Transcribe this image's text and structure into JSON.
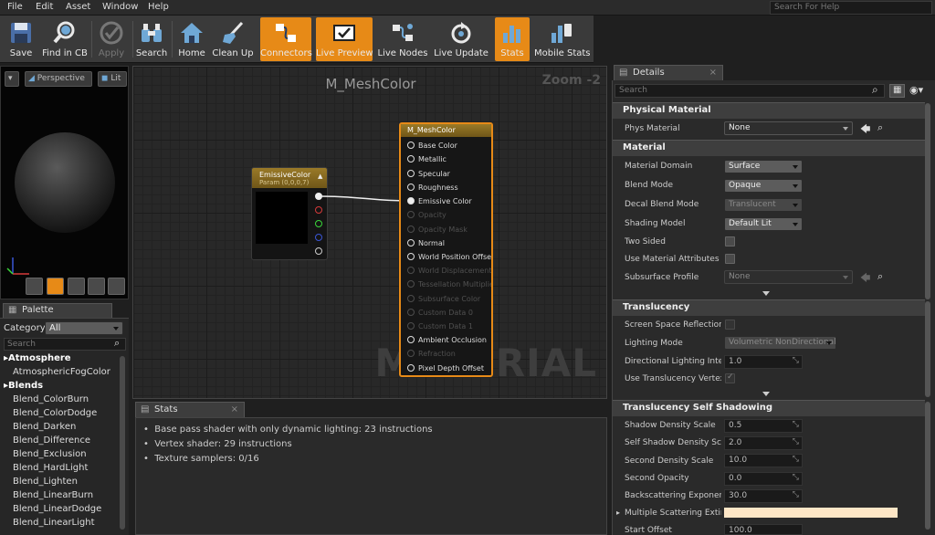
{
  "menu": [
    "File",
    "Edit",
    "Asset",
    "Window",
    "Help"
  ],
  "help_search_placeholder": "Search For Help",
  "toolbar": {
    "buttons": [
      {
        "label": "Save",
        "icon": "save-icon",
        "active": false,
        "enabled": true
      },
      {
        "label": "Find in CB",
        "icon": "find-in-content-browser-icon",
        "active": false,
        "enabled": true
      },
      {
        "label": "Apply",
        "icon": "apply-checkmark-icon",
        "active": false,
        "enabled": false
      },
      {
        "label": "Search",
        "icon": "binoculars-icon",
        "active": false,
        "enabled": true
      },
      {
        "label": "Home",
        "icon": "home-icon",
        "active": false,
        "enabled": true
      },
      {
        "label": "Clean Up",
        "icon": "broom-icon",
        "active": false,
        "enabled": true
      },
      {
        "label": "Connectors",
        "icon": "connectors-icon",
        "active": true,
        "enabled": true
      },
      {
        "label": "Live Preview",
        "icon": "live-preview-icon",
        "active": true,
        "enabled": true
      },
      {
        "label": "Live Nodes",
        "icon": "live-nodes-icon",
        "active": false,
        "enabled": true
      },
      {
        "label": "Live Update",
        "icon": "live-update-icon",
        "active": false,
        "enabled": true
      },
      {
        "label": "Stats",
        "icon": "stats-icon",
        "active": true,
        "enabled": true
      },
      {
        "label": "Mobile Stats",
        "icon": "mobile-stats-icon",
        "active": false,
        "enabled": true
      }
    ]
  },
  "viewport": {
    "perspective": "Perspective",
    "lit": "Lit"
  },
  "palette": {
    "tab": "Palette",
    "category_label": "Category:",
    "category_value": "All",
    "search_placeholder": "Search",
    "groups": [
      {
        "name": "Atmosphere",
        "items": [
          "AtmosphericFogColor"
        ]
      },
      {
        "name": "Blends",
        "items": [
          "Blend_ColorBurn",
          "Blend_ColorDodge",
          "Blend_Darken",
          "Blend_Difference",
          "Blend_Exclusion",
          "Blend_HardLight",
          "Blend_Lighten",
          "Blend_LinearBurn",
          "Blend_LinearDodge",
          "Blend_LinearLight"
        ]
      }
    ]
  },
  "graph": {
    "title": "M_MeshColor",
    "zoom": "Zoom -2",
    "watermark": "MATERIAL",
    "param_node": {
      "title": "EmissiveColor",
      "subtitle": "Param (0,0,0,7)"
    },
    "material_node": {
      "title": "M_MeshColor",
      "pins": [
        {
          "label": "Base Color",
          "enabled": true
        },
        {
          "label": "Metallic",
          "enabled": true
        },
        {
          "label": "Specular",
          "enabled": true
        },
        {
          "label": "Roughness",
          "enabled": true
        },
        {
          "label": "Emissive Color",
          "enabled": true,
          "connected": true
        },
        {
          "label": "Opacity",
          "enabled": false
        },
        {
          "label": "Opacity Mask",
          "enabled": false
        },
        {
          "label": "Normal",
          "enabled": true
        },
        {
          "label": "World Position Offset",
          "enabled": true
        },
        {
          "label": "World Displacement",
          "enabled": false
        },
        {
          "label": "Tessellation Multiplier",
          "enabled": false
        },
        {
          "label": "Subsurface Color",
          "enabled": false
        },
        {
          "label": "Custom Data 0",
          "enabled": false
        },
        {
          "label": "Custom Data 1",
          "enabled": false
        },
        {
          "label": "Ambient Occlusion",
          "enabled": true
        },
        {
          "label": "Refraction",
          "enabled": false
        },
        {
          "label": "Pixel Depth Offset",
          "enabled": true
        }
      ]
    }
  },
  "stats": {
    "tab": "Stats",
    "lines": [
      "Base pass shader with only dynamic lighting: 23 instructions",
      "Vertex shader: 29 instructions",
      "Texture samplers: 0/16"
    ]
  },
  "details": {
    "tab": "Details",
    "search_placeholder": "Search",
    "sections": {
      "physical_material": "Physical Material",
      "material": "Material",
      "translucency": "Translucency",
      "translucency_self_shadowing": "Translucency Self Shadowing"
    },
    "phys_material": {
      "label": "Phys Material",
      "value": "None"
    },
    "material_domain": {
      "label": "Material Domain",
      "value": "Surface"
    },
    "blend_mode": {
      "label": "Blend Mode",
      "value": "Opaque"
    },
    "decal_blend_mode": {
      "label": "Decal Blend Mode",
      "value": "Translucent"
    },
    "shading_model": {
      "label": "Shading Model",
      "value": "Default Lit"
    },
    "two_sided": {
      "label": "Two Sided"
    },
    "use_material_attributes": {
      "label": "Use Material Attributes"
    },
    "subsurface_profile": {
      "label": "Subsurface Profile",
      "value": "None"
    },
    "screen_space_reflections": {
      "label": "Screen Space Reflections"
    },
    "lighting_mode": {
      "label": "Lighting Mode",
      "value": "Volumetric NonDirectional"
    },
    "directional_lighting_intensity": {
      "label": "Directional Lighting Intens",
      "value": "1.0"
    },
    "use_translucency_vertex": {
      "label": "Use Translucency Vertex"
    },
    "shadow_density_scale": {
      "label": "Shadow Density Scale",
      "value": "0.5"
    },
    "self_shadow_density_scale": {
      "label": "Self Shadow Density Scale",
      "value": "2.0"
    },
    "second_density_scale": {
      "label": "Second Density Scale",
      "value": "10.0"
    },
    "second_opacity": {
      "label": "Second Opacity",
      "value": "0.0"
    },
    "backscattering_exponent": {
      "label": "Backscattering Exponent",
      "value": "30.0"
    },
    "multiple_scattering_extinction": {
      "label": "Multiple Scattering Extinc"
    },
    "start_offset": {
      "label": "Start Offset",
      "value": "100.0"
    }
  },
  "colors": {
    "accent": "#e78a17",
    "node_header": "#8c6d1f",
    "multiple_scattering_swatch": "#fde6c6"
  }
}
